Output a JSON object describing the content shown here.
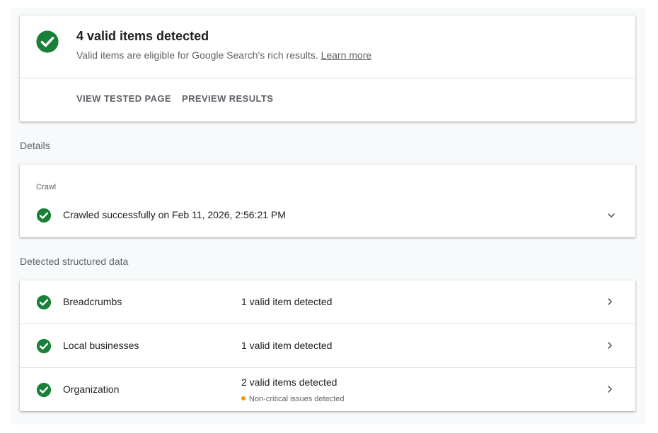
{
  "colors": {
    "success_green": "#188038",
    "warning_orange": "#f29900",
    "muted_text": "#5f6368",
    "primary_text": "#202124"
  },
  "summary": {
    "icon": "check-circle-icon",
    "title": "4 valid items detected",
    "subtitle": "Valid items are eligible for Google Search's rich results.",
    "learn_more": "Learn more",
    "actions": {
      "view_tested_page": "VIEW TESTED PAGE",
      "preview_results": "PREVIEW RESULTS"
    }
  },
  "details": {
    "label": "Details",
    "crawl": {
      "header": "Crawl",
      "icon": "check-circle-icon",
      "status": "Crawled successfully on Feb 11, 2026, 2:56:21 PM",
      "expand_icon": "chevron-down-icon"
    }
  },
  "structured_data": {
    "label": "Detected structured data",
    "items": [
      {
        "name": "Breadcrumbs",
        "status": "1 valid item detected",
        "note": ""
      },
      {
        "name": "Local businesses",
        "status": "1 valid item detected",
        "note": ""
      },
      {
        "name": "Organization",
        "status": "2 valid items detected",
        "note": "Non-critical issues detected"
      }
    ]
  }
}
